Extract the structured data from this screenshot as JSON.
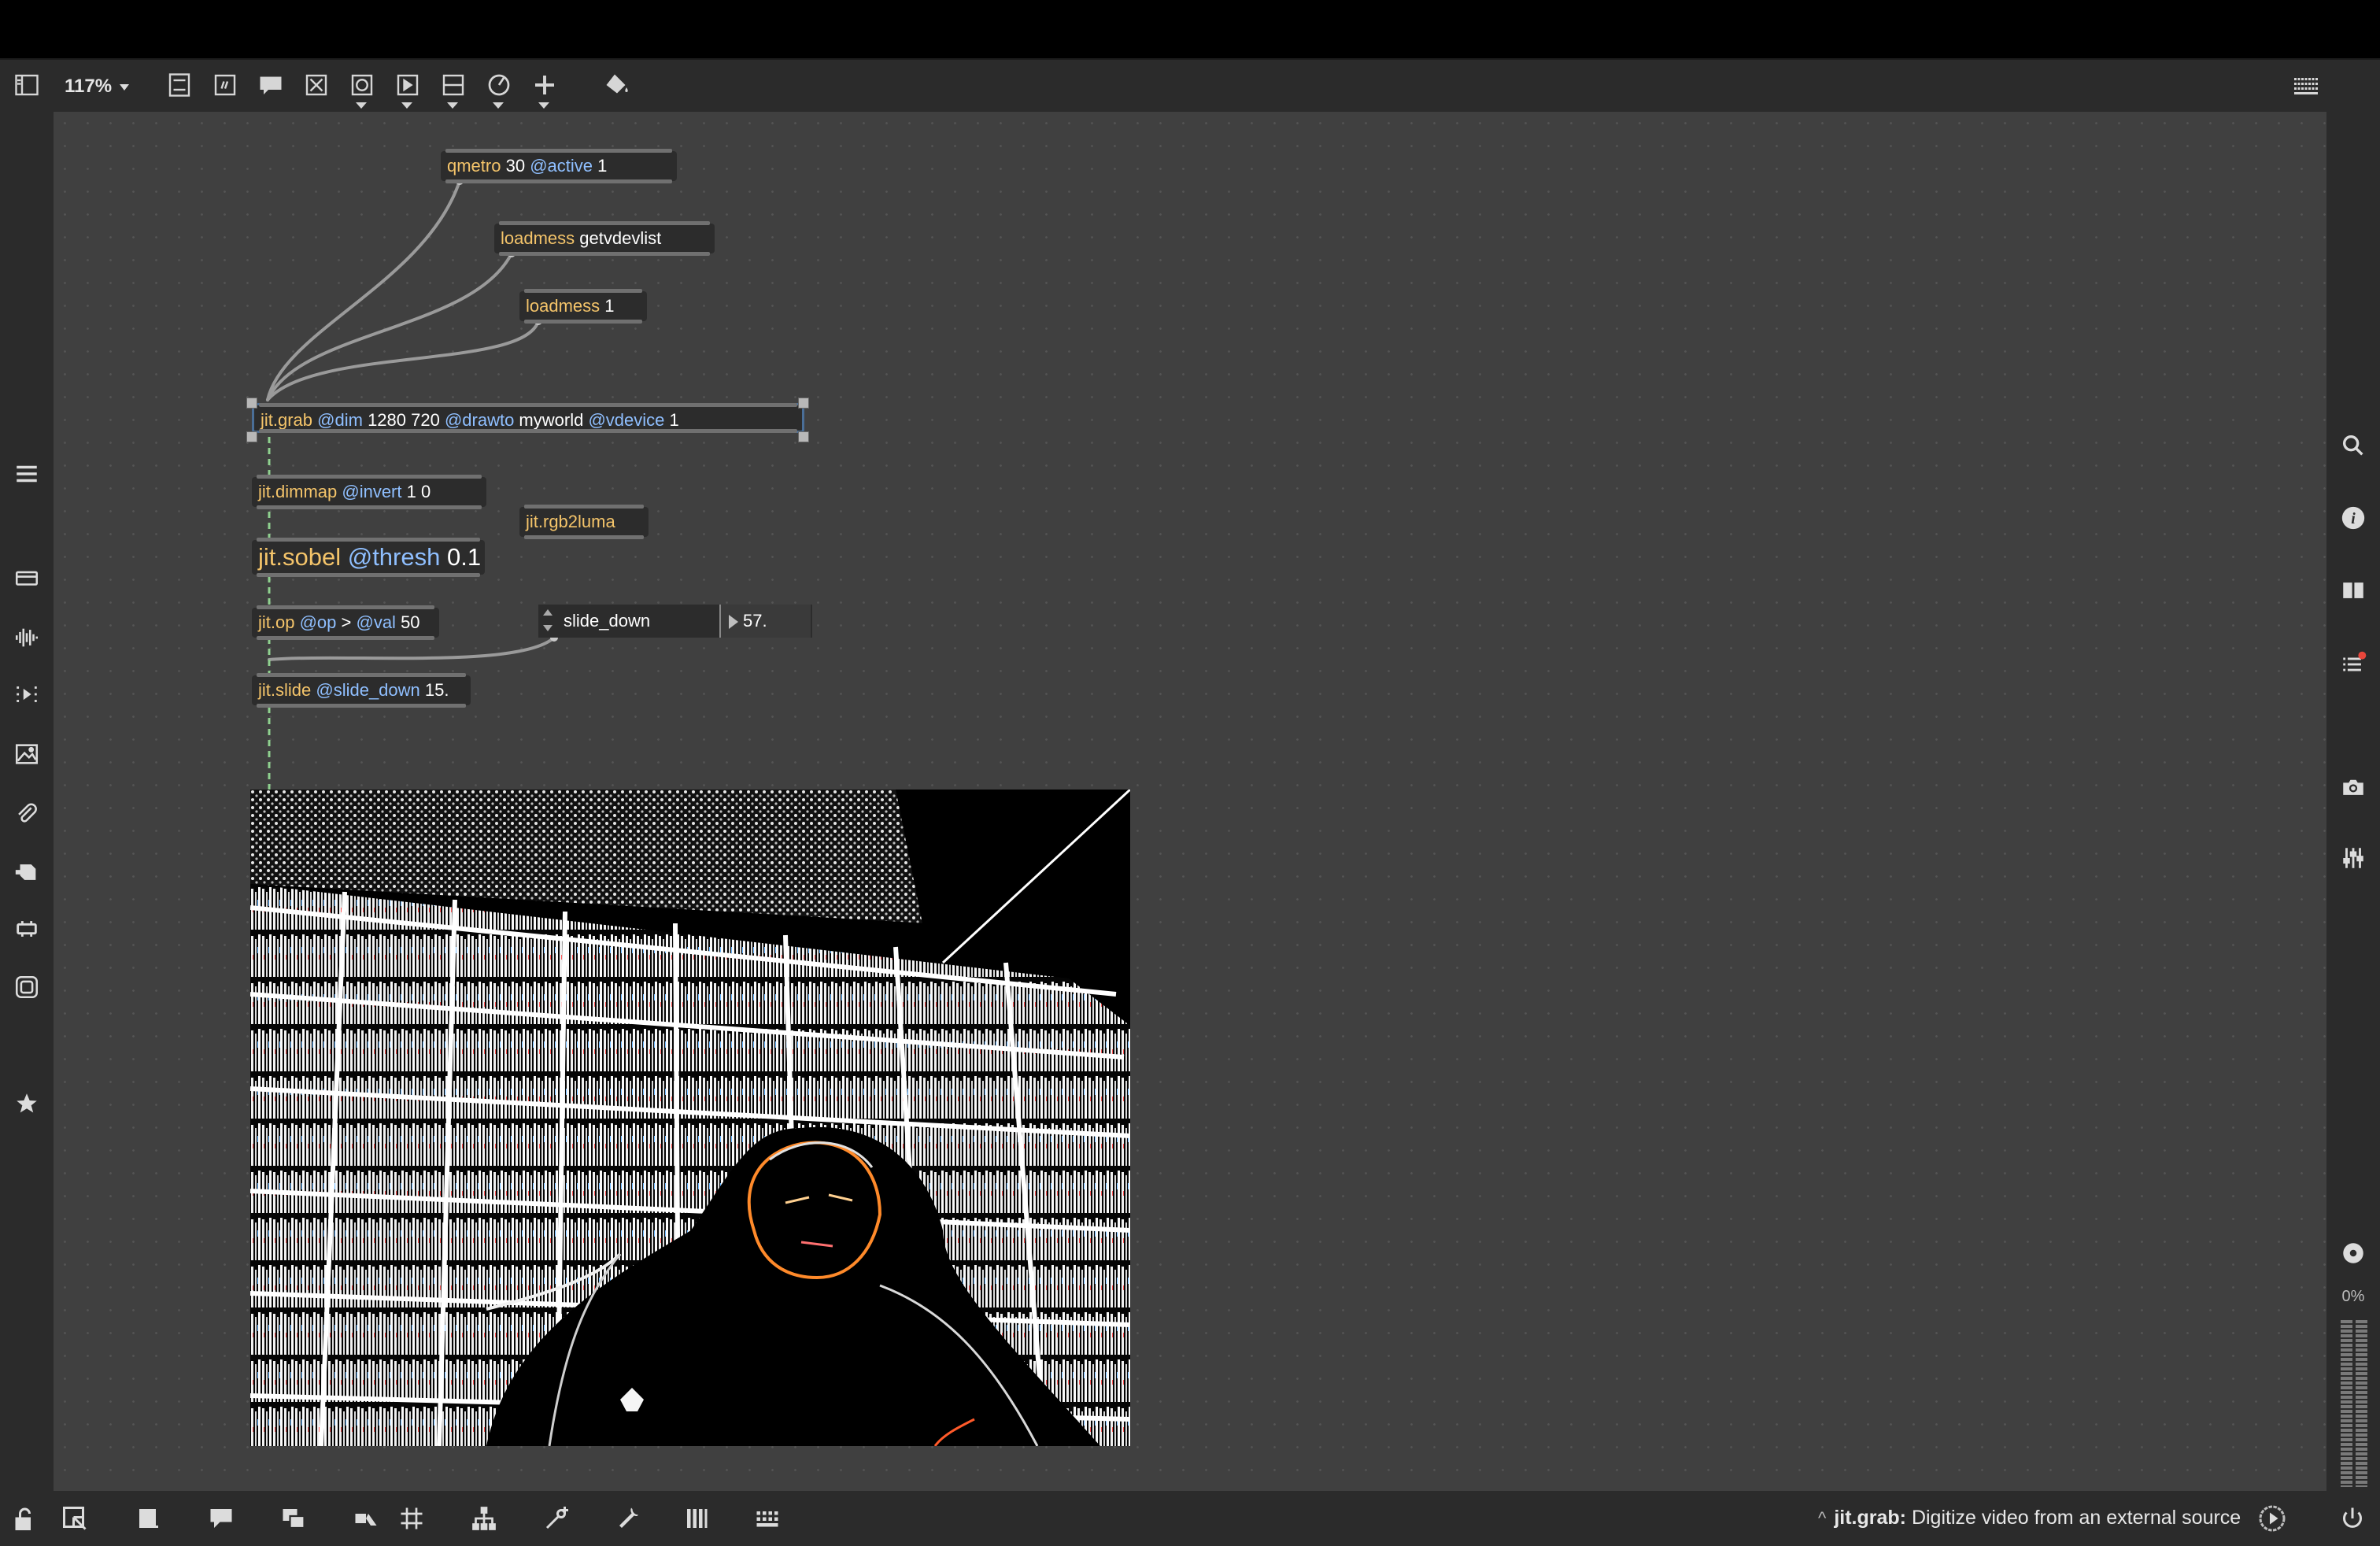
{
  "toolbar": {
    "zoom": "117%",
    "icons": [
      "sidebar-toggle-icon",
      "presentation-icon",
      "text-icon",
      "comment-icon",
      "toggle-box-icon",
      "button-icon",
      "play-object-icon",
      "slider-icon",
      "dial-icon",
      "add-icon",
      "paint-bucket-icon",
      "grid-keyboard-icon"
    ]
  },
  "patch": {
    "objects": [
      {
        "id": "qmetro",
        "cls": "qmetro",
        "args": [
          {
            "t": "arg",
            "v": " 30 "
          },
          {
            "t": "attr",
            "v": "@active"
          },
          {
            "t": "arg",
            "v": " 1"
          }
        ]
      },
      {
        "id": "loadmess-getvdevlist",
        "cls": "loadmess",
        "args": [
          {
            "t": "arg",
            "v": " getvdevlist"
          }
        ]
      },
      {
        "id": "loadmess-1",
        "cls": "loadmess",
        "args": [
          {
            "t": "arg",
            "v": " 1"
          }
        ]
      },
      {
        "id": "jit-grab",
        "cls": "jit.grab",
        "args": [
          {
            "t": "attr",
            "v": " @dim"
          },
          {
            "t": "arg",
            "v": " 1280 720 "
          },
          {
            "t": "attr",
            "v": "@drawto"
          },
          {
            "t": "arg",
            "v": " myworld "
          },
          {
            "t": "attr",
            "v": "@vdevice"
          },
          {
            "t": "arg",
            "v": " 1"
          }
        ]
      },
      {
        "id": "jit-dimmap",
        "cls": "jit.dimmap",
        "args": [
          {
            "t": "attr",
            "v": " @invert"
          },
          {
            "t": "arg",
            "v": " 1 0"
          }
        ]
      },
      {
        "id": "jit-rgb2luma",
        "cls": "jit.rgb2luma",
        "args": []
      },
      {
        "id": "jit-sobel",
        "cls": "jit.sobel",
        "args": [
          {
            "t": "attr",
            "v": " @thresh"
          },
          {
            "t": "arg",
            "v": " 0.1"
          }
        ]
      },
      {
        "id": "jit-op",
        "cls": "jit.op",
        "args": [
          {
            "t": "attr",
            "v": " @op"
          },
          {
            "t": "arg",
            "v": " > "
          },
          {
            "t": "attr",
            "v": "@val"
          },
          {
            "t": "arg",
            "v": " 50"
          }
        ]
      },
      {
        "id": "jit-slide",
        "cls": "jit.slide",
        "args": [
          {
            "t": "attr",
            "v": " @slide_down"
          },
          {
            "t": "arg",
            "v": " 15."
          }
        ]
      }
    ],
    "attrui": {
      "label": "slide_down",
      "value": "57."
    }
  },
  "rightbar": {
    "meter_label": "0%"
  },
  "status": {
    "object": "jit.grab:",
    "description": " Digitize video from an external source"
  },
  "colors": {
    "canvas": "#404040",
    "class_text": "#f4c46a",
    "attr_text": "#8fbfff",
    "patch_cord": "#9a9a9a",
    "matrix_cord": "#8fd18f"
  }
}
